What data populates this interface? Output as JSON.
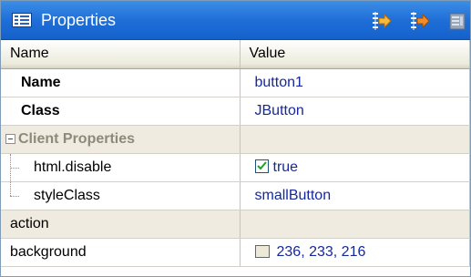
{
  "panel": {
    "title": "Properties"
  },
  "toolbar": {
    "buttons": [
      {
        "name": "sort-by-category",
        "icon": "sort-category-icon"
      },
      {
        "name": "sort-alphabetical",
        "icon": "sort-alpha-icon"
      },
      {
        "name": "show-help",
        "icon": "help-panel-icon"
      }
    ]
  },
  "table": {
    "headers": {
      "name": "Name",
      "value": "Value"
    },
    "rows": [
      {
        "name": "Name",
        "value": "button1"
      },
      {
        "name": "Class",
        "value": "JButton"
      },
      {
        "name": "Client Properties",
        "value": ""
      },
      {
        "name": "html.disable",
        "value": "true",
        "checked": true
      },
      {
        "name": "styleClass",
        "value": "smallButton"
      },
      {
        "name": "action",
        "value": ""
      },
      {
        "name": "background",
        "value": "236, 233, 216",
        "swatch_color": "#ece9d8"
      }
    ]
  },
  "colors": {
    "title_bar": "#1f6fd8",
    "value_text": "#15289c",
    "category_bg": "#efebe0"
  }
}
